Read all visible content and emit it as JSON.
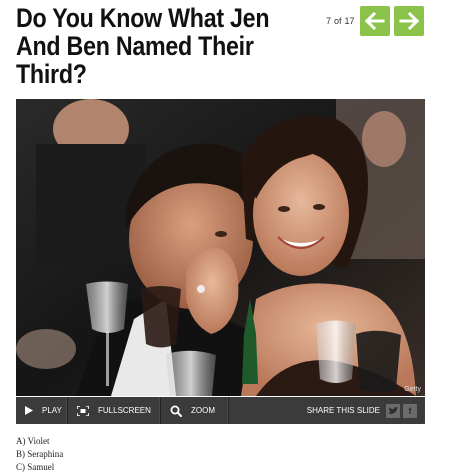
{
  "slide": {
    "title": "Do You Know What Jen And Ben Named Their Third?",
    "counter_current": "7",
    "counter_of": "of",
    "counter_total": "17"
  },
  "nav": {
    "prev_icon": "arrow-left-icon",
    "next_icon": "arrow-right-icon",
    "accent_color": "#8bc34a"
  },
  "photo": {
    "credit": "Getty"
  },
  "controls": {
    "play_label": "PLAY",
    "fullscreen_label": "FULLSCREEN",
    "zoom_label": "ZOOM",
    "share_label": "SHARE THIS SLIDE",
    "twitter_icon": "twitter-icon",
    "facebook_icon": "facebook-icon"
  },
  "answers": [
    "A) Violet",
    "B) Seraphina",
    "C) Samuel"
  ]
}
